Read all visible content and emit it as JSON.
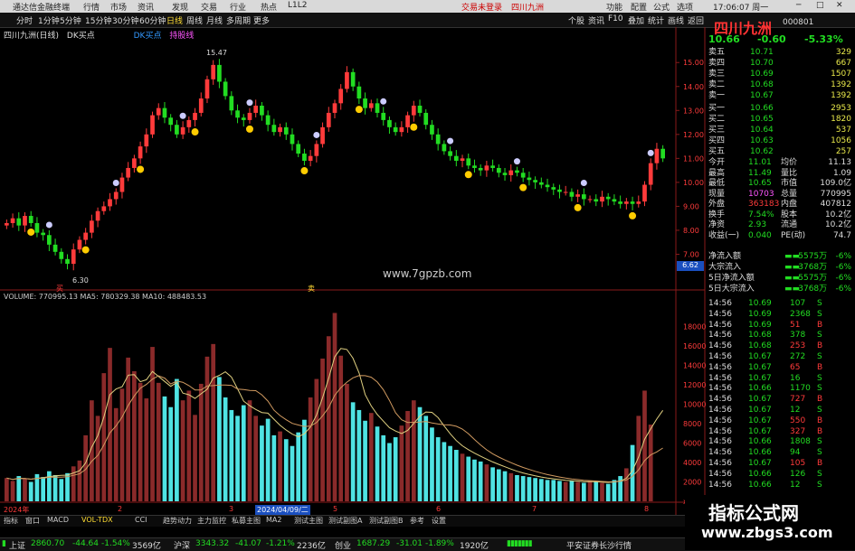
{
  "titlebar": {
    "app": "通达信金融终端",
    "menus": [
      "行情",
      "市场",
      "资讯",
      "发现",
      "交易",
      "行业",
      "热点",
      "L1L2"
    ],
    "center_left": "交易未登录",
    "center_right": "四川九洲",
    "right_items": [
      "功能",
      "配置",
      "公式",
      "选项",
      "17:06:07 周一"
    ]
  },
  "toolbar": {
    "periods": [
      "分时",
      "1分钟",
      "5分钟",
      "15分钟",
      "30分钟",
      "60分钟",
      "日线",
      "周线",
      "月线",
      "多周期",
      "更多"
    ],
    "right_items": [
      "个股",
      "资讯",
      "F10",
      "叠加",
      "统计",
      "画线",
      "返回"
    ]
  },
  "kline_header": {
    "stock": "四川九洲(日线)",
    "indicator": "DK买点",
    "ind_labels": [
      "DK买点",
      "持股线"
    ]
  },
  "price_axis": {
    "ticks": [
      "15.00",
      "14.00",
      "13.00",
      "12.00",
      "11.00",
      "10.00",
      "9.00",
      "8.00",
      "7.00"
    ],
    "marker": "6.62"
  },
  "annotations": {
    "high": "15.47",
    "low": "6.30",
    "buy_label1": "买",
    "buy_label2": "卖",
    "site": "www.7gpzb.com"
  },
  "volume_header": {
    "text": "VOLUME: 770995.13  MA5: 780329.38  MA10: 488483.53"
  },
  "volume_axis": {
    "ticks": [
      "18000",
      "16000",
      "14000",
      "12000",
      "10000",
      "8000",
      "6000",
      "4000",
      "2000",
      "x10"
    ]
  },
  "xaxis": {
    "labels": [
      "2024年",
      "2",
      "3",
      "2024/04/09/二",
      "5",
      "6",
      "7",
      "8"
    ]
  },
  "quote": {
    "name": "四川九洲",
    "code": "000801",
    "price": "10.66",
    "change": "-0.60",
    "pct": "-5.33%",
    "asks": [
      {
        "label": "卖五",
        "price": "10.71",
        "vol": "329"
      },
      {
        "label": "卖四",
        "price": "10.70",
        "vol": "667"
      },
      {
        "label": "卖三",
        "price": "10.69",
        "vol": "1507"
      },
      {
        "label": "卖二",
        "price": "10.68",
        "vol": "1392"
      },
      {
        "label": "卖一",
        "price": "10.67",
        "vol": "1392"
      }
    ],
    "bids": [
      {
        "label": "买一",
        "price": "10.66",
        "vol": "2953"
      },
      {
        "label": "买二",
        "price": "10.65",
        "vol": "1820"
      },
      {
        "label": "买三",
        "price": "10.64",
        "vol": "537"
      },
      {
        "label": "买四",
        "price": "10.63",
        "vol": "1056"
      },
      {
        "label": "买五",
        "price": "10.62",
        "vol": "257"
      }
    ],
    "stats": [
      {
        "l1": "今开",
        "v1": "11.01",
        "l2": "均价",
        "v2": "11.13"
      },
      {
        "l1": "最高",
        "v1": "11.49",
        "l2": "量比",
        "v2": "1.09"
      },
      {
        "l1": "最低",
        "v1": "10.65",
        "l2": "市值",
        "v2": "109.0亿"
      },
      {
        "l1": "现量",
        "v1": "10703",
        "l2": "总量",
        "v2": "770995"
      },
      {
        "l1": "外盘",
        "v1": "363183",
        "l2": "内盘",
        "v2": "407812"
      },
      {
        "l1": "换手",
        "v1": "7.54%",
        "l2": "股本",
        "v2": "10.2亿"
      },
      {
        "l1": "净资",
        "v1": "2.93",
        "l2": "流通",
        "v2": "10.2亿"
      },
      {
        "l1": "收益(一)",
        "v1": "0.040",
        "l2": "PE(动)",
        "v2": "74.7"
      }
    ],
    "flows": [
      {
        "label": "净流入额",
        "value": "-5575万",
        "pct": "-6%"
      },
      {
        "label": "大宗流入",
        "value": "-3768万",
        "pct": "-6%"
      },
      {
        "label": "5日净流入额",
        "value": "-5575万",
        "pct": "-6%"
      },
      {
        "label": "5日大宗流入",
        "value": "-3768万",
        "pct": "-6%"
      }
    ],
    "ticks": [
      {
        "t": "14:56",
        "p": "10.69",
        "v": "107",
        "s": "S"
      },
      {
        "t": "14:56",
        "p": "10.69",
        "v": "2368",
        "s": "S"
      },
      {
        "t": "14:56",
        "p": "10.69",
        "v": "51",
        "s": "B"
      },
      {
        "t": "14:56",
        "p": "10.68",
        "v": "378",
        "s": "S"
      },
      {
        "t": "14:56",
        "p": "10.68",
        "v": "253",
        "s": "B"
      },
      {
        "t": "14:56",
        "p": "10.67",
        "v": "272",
        "s": "S"
      },
      {
        "t": "14:56",
        "p": "10.67",
        "v": "65",
        "s": "B"
      },
      {
        "t": "14:56",
        "p": "10.67",
        "v": "16",
        "s": "S"
      },
      {
        "t": "14:56",
        "p": "10.66",
        "v": "1170",
        "s": "S"
      },
      {
        "t": "14:56",
        "p": "10.67",
        "v": "727",
        "s": "B"
      },
      {
        "t": "14:56",
        "p": "10.67",
        "v": "12",
        "s": "S"
      },
      {
        "t": "14:56",
        "p": "10.67",
        "v": "550",
        "s": "B"
      },
      {
        "t": "14:56",
        "p": "10.67",
        "v": "327",
        "s": "B"
      },
      {
        "t": "14:56",
        "p": "10.66",
        "v": "1808",
        "s": "S"
      },
      {
        "t": "14:56",
        "p": "10.66",
        "v": "94",
        "s": "S"
      },
      {
        "t": "14:56",
        "p": "10.67",
        "v": "105",
        "s": "B"
      },
      {
        "t": "14:56",
        "p": "10.66",
        "v": "126",
        "s": "S"
      },
      {
        "t": "14:56",
        "p": "10.66",
        "v": "12",
        "s": "S"
      }
    ]
  },
  "tabs": [
    "指标",
    "窗口",
    "MACD",
    "VOL-TDX",
    "CCI",
    "趋势动力",
    "主力监控",
    "私募主图",
    "MA2",
    "测试主图",
    "测试副图A",
    "测试副图B",
    "参考",
    "设置"
  ],
  "status": [
    {
      "name": "上证",
      "val": "2860.70",
      "chg": "-44.64",
      "pct": "-1.54%",
      "amt": "3569亿"
    },
    {
      "name": "沪深",
      "val": "3343.32",
      "chg": "-41.07",
      "pct": "-1.21%",
      "amt": "2236亿"
    },
    {
      "name": "创业",
      "val": "1687.29",
      "chg": "-31.01",
      "pct": "-1.89%",
      "amt": "1920亿"
    }
  ],
  "status_right": "平安证券长沙行情",
  "watermark": {
    "line1": "指标公式网",
    "line2": "www.zbgs3.com"
  },
  "colors": {
    "up": "#ff3b3b",
    "down": "#22dd22",
    "vol_up": "#8a2a2a",
    "vol_down": "#4fe3e3"
  },
  "chart_data": {
    "type": "candlestick",
    "title": "四川九洲(日线)",
    "ylim": [
      6.0,
      15.8
    ],
    "closes": [
      8.3,
      8.5,
      8.2,
      8.6,
      8.3,
      7.9,
      7.8,
      7.4,
      7.1,
      6.8,
      6.6,
      7.2,
      7.6,
      7.9,
      8.4,
      8.8,
      9.0,
      9.3,
      9.6,
      10.2,
      10.6,
      11.0,
      11.5,
      12.0,
      12.8,
      13.1,
      12.7,
      12.4,
      12.0,
      12.3,
      12.6,
      12.9,
      13.5,
      14.3,
      14.9,
      14.2,
      13.6,
      13.0,
      12.7,
      12.6,
      12.9,
      13.2,
      12.8,
      12.4,
      12.1,
      12.3,
      12.0,
      11.6,
      11.2,
      10.9,
      11.1,
      11.6,
      12.3,
      12.9,
      13.3,
      13.9,
      14.6,
      14.0,
      13.5,
      13.1,
      13.3,
      12.9,
      12.6,
      12.3,
      12.1,
      12.3,
      12.8,
      13.2,
      12.9,
      12.4,
      12.0,
      11.6,
      11.3,
      11.1,
      10.9,
      11.0,
      10.7,
      10.6,
      10.5,
      10.7,
      10.6,
      10.4,
      10.3,
      10.5,
      10.4,
      10.2,
      10.1,
      10.0,
      9.9,
      9.8,
      9.7,
      9.6,
      9.6,
      9.4,
      9.5,
      9.3,
      9.3,
      9.2,
      9.4,
      9.3,
      9.2,
      9.1,
      9.2,
      9.1,
      9.2,
      9.9,
      10.8,
      11.4,
      11.0
    ],
    "volumes": [
      2400,
      2100,
      2600,
      2300,
      2000,
      2800,
      2500,
      3100,
      2700,
      2300,
      2900,
      3600,
      4200,
      6800,
      10400,
      8800,
      13200,
      15800,
      9600,
      11600,
      14800,
      13400,
      12200,
      10600,
      15900,
      12200,
      10800,
      9700,
      12600,
      10400,
      11400,
      8900,
      12100,
      14900,
      16200,
      12800,
      10700,
      9400,
      8800,
      9900,
      10400,
      8800,
      7800,
      8500,
      6800,
      7200,
      6400,
      5700,
      7100,
      8400,
      10700,
      12600,
      14700,
      17000,
      19400,
      15000,
      12100,
      10200,
      9400,
      8300,
      9100,
      7700,
      6800,
      6000,
      6600,
      7800,
      9300,
      10400,
      9700,
      8800,
      7600,
      6600,
      6100,
      5700,
      5300,
      4900,
      4600,
      4300,
      4100,
      3800,
      3500,
      3300,
      3100,
      2900,
      2700,
      2600,
      2500,
      2400,
      2300,
      2200,
      2200,
      2100,
      2000,
      2100,
      2000,
      1900,
      2100,
      2000,
      1900,
      1800,
      2200,
      2600,
      3400,
      5800,
      8800,
      11400,
      7900
    ]
  }
}
